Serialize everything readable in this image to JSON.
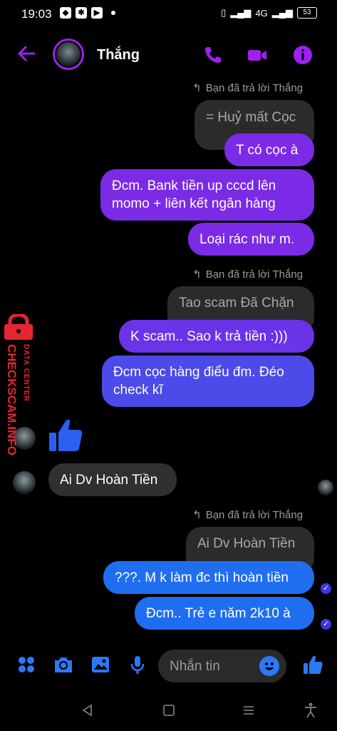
{
  "status_bar": {
    "time": "19:03",
    "network": "4G",
    "battery": "53"
  },
  "header": {
    "contact_name": "Thắng"
  },
  "reply_label": "Bạn đã trả lời Thắng",
  "messages": {
    "q1": "= Huỷ mất Cọc",
    "m1": "T có cọc à",
    "m2_line1": "Đcm. Bank tiền up cccd lên",
    "m2_line2": "momo + liên kết ngân hàng",
    "m3": "Loại rác như m.",
    "q2": "Tao scam Đã Chặn",
    "m4": "K scam.. Sao k trả tiền :)))",
    "m5_line1": "Đcm cọc hàng điểu đm. Đéo",
    "m5_line2": "check kĩ",
    "incoming1": "Ai Dv Hoàn Tiền",
    "q3": "Ai Dv Hoàn Tiền",
    "m6": "???. M k làm đc thì hoàn tiền",
    "m7": "Đcm.. Trẻ e năm 2k10 à"
  },
  "watermark": {
    "top": "DATA CENTER",
    "main": "CHECKSCAM.INFO"
  },
  "composer": {
    "placeholder": "Nhắn tin"
  },
  "colors": {
    "accent": "#a020f0",
    "blue": "#1f6ef0",
    "watermark": "#e3262f"
  }
}
